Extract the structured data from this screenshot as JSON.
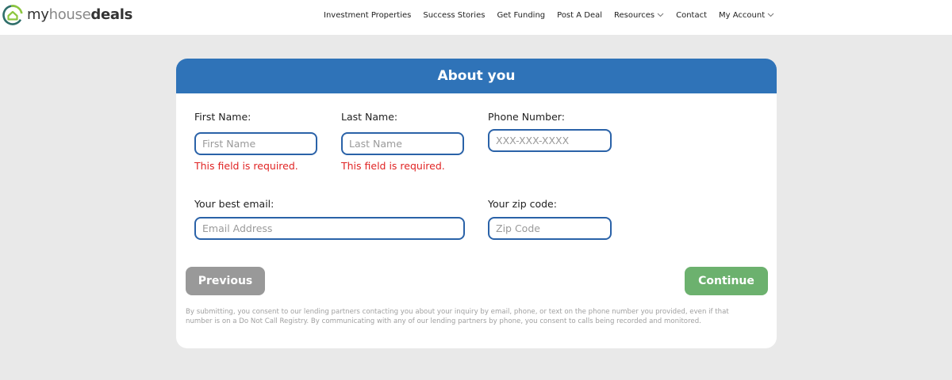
{
  "brand": {
    "part1": "my",
    "part2": "house",
    "part3": "deals"
  },
  "nav": {
    "items": [
      {
        "label": "Investment Properties",
        "dropdown": false
      },
      {
        "label": "Success Stories",
        "dropdown": false
      },
      {
        "label": "Get Funding",
        "dropdown": false
      },
      {
        "label": "Post A Deal",
        "dropdown": false
      },
      {
        "label": "Resources",
        "dropdown": true
      },
      {
        "label": "Contact",
        "dropdown": false
      },
      {
        "label": "My Account",
        "dropdown": true
      }
    ]
  },
  "form": {
    "title": "About you",
    "first_name": {
      "label": "First Name:",
      "placeholder": "First Name",
      "value": "",
      "error": "This field is required."
    },
    "last_name": {
      "label": "Last Name:",
      "placeholder": "Last Name",
      "value": "",
      "error": "This field is required."
    },
    "phone": {
      "label": "Phone Number:",
      "placeholder": "XXX-XXX-XXXX",
      "value": ""
    },
    "email": {
      "label": "Your best email:",
      "placeholder": "Email Address",
      "value": ""
    },
    "zip": {
      "label": "Your zip code:",
      "placeholder": "Zip Code",
      "value": ""
    },
    "previous_label": "Previous",
    "continue_label": "Continue",
    "disclaimer": "By submitting, you consent to our lending partners contacting you about your inquiry by email, phone, or text on the phone number you provided, even if that number is on a Do Not Call Registry. By communicating with any of our lending partners by phone, you consent to calls being recorded and monitored."
  },
  "colors": {
    "header_bar": "#2f73b8",
    "field_border": "#2a62a8",
    "error": "#e02424",
    "continue": "#6cb16e",
    "previous": "#999999",
    "background": "#e9e9e9"
  },
  "icons": {
    "logo": "house-circle-logo-icon",
    "dropdown": "chevron-down-icon"
  }
}
